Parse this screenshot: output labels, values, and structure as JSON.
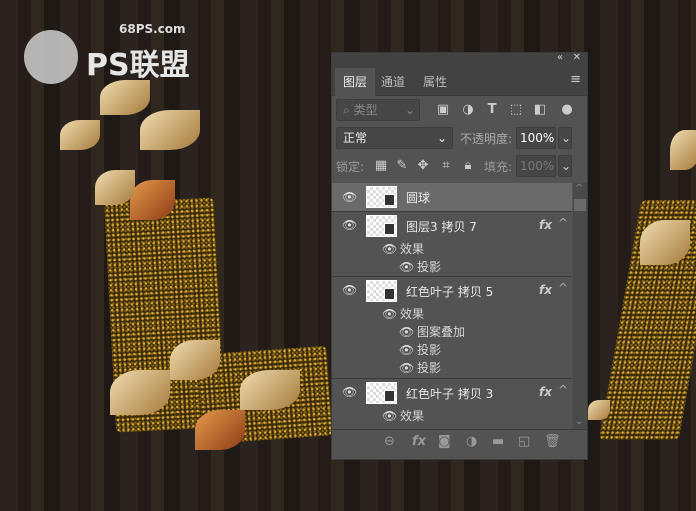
{
  "logo": {
    "site": "68PS.com",
    "name": "PS联盟"
  },
  "panel": {
    "collapse_icon": "double-chevron-icon",
    "close_icon": "close-icon",
    "tabs": [
      {
        "label": "图层",
        "active": true
      },
      {
        "label": "通道"
      },
      {
        "label": "属性"
      }
    ],
    "filter": {
      "kind": "类型",
      "icons": [
        "image-filter-icon",
        "adjustment-filter-icon",
        "type-filter-icon",
        "shape-filter-icon",
        "smart-object-filter-icon"
      ]
    },
    "blend_mode": "正常",
    "opacity_label": "不透明度:",
    "opacity": "100%",
    "lock_label": "锁定:",
    "fill_label": "填充:",
    "fill": "100%",
    "layers": [
      {
        "name": "圆球",
        "selected": true,
        "effects": []
      },
      {
        "name": "图层3 拷贝 7",
        "fx": "fx",
        "effects_label": "效果",
        "effects": [
          "投影"
        ]
      },
      {
        "name": "红色叶子 拷贝 5",
        "fx": "fx",
        "effects_label": "效果",
        "effects": [
          "图案叠加",
          "投影",
          "投影"
        ]
      },
      {
        "name": "红色叶子 拷贝 3",
        "fx": "fx",
        "effects_label": "效果",
        "effects": []
      }
    ],
    "bottom_icons": [
      "link-icon",
      "fx-icon",
      "mask-icon",
      "adjustment-icon",
      "folder-icon",
      "new-layer-icon",
      "trash-icon"
    ]
  }
}
